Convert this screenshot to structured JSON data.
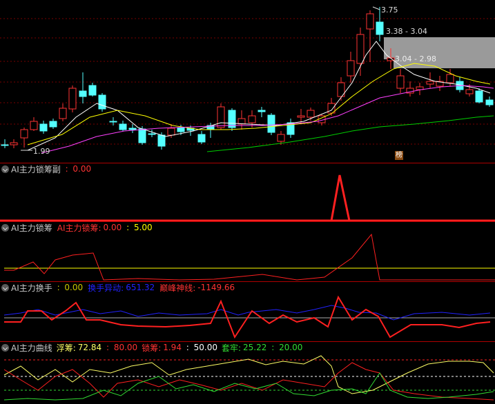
{
  "main_chart": {
    "price_labels": {
      "high": "3.75",
      "low": "1.99"
    },
    "zones": [
      {
        "label": "3.38 - 3.04"
      },
      {
        "label": "3.04 - 2.98"
      }
    ],
    "marker_glyph": "榜",
    "colors": {
      "up": "#ff3333",
      "down": "#54ffff",
      "ma1": "#ffffff",
      "ma2": "#ffff00",
      "ma3": "#ff40ff",
      "ma4": "#00d000"
    }
  },
  "panel1": {
    "name": "AI主力锁筹副",
    "value_sep": " : ",
    "value": "0.00"
  },
  "panel2": {
    "name": "AI主力锁筹",
    "series1_label": "AI主力锁筹:",
    "series1_value": "0.00",
    "sep": " : ",
    "value2": "5.00"
  },
  "panel3": {
    "name": "AI主力换手",
    "sep0": " : ",
    "value0": "0.00",
    "s2_label": "换手异动:",
    "s2_value": "651.32",
    "s3_label": "巅峰神线:",
    "s3_value": "-1149.66"
  },
  "panel4": {
    "name": "AI主力曲线",
    "s1_label": "浮筹:",
    "s1_value": "72.84",
    "sep": " : ",
    "s2_value": "80.00",
    "s3_label": "锁筹:",
    "s3_value": "1.94",
    "s4_value": "50.00",
    "s5_label": "套牢:",
    "s5_value": "25.22",
    "s6_value": "20.00"
  }
}
